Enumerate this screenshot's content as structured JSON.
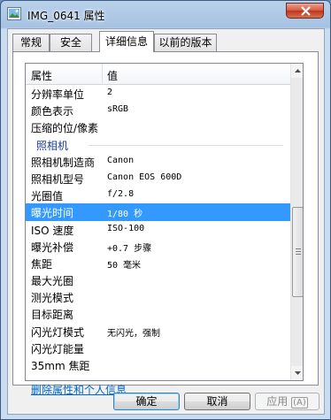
{
  "window": {
    "title": "IMG_0641 属性"
  },
  "tabs": [
    {
      "label": "常规",
      "active": false
    },
    {
      "label": "安全",
      "active": false
    },
    {
      "label": "详细信息",
      "active": true
    },
    {
      "label": "以前的版本",
      "active": false
    }
  ],
  "list": {
    "headers": {
      "name": "属性",
      "value": "值"
    },
    "rows": [
      {
        "name": "分辨率单位",
        "value": "2"
      },
      {
        "name": "颜色表示",
        "value": "sRGB"
      },
      {
        "name": "压缩的位/像素",
        "value": ""
      },
      {
        "name": "照相机",
        "value": "",
        "group": true
      },
      {
        "name": "照相机制造商",
        "value": "Canon"
      },
      {
        "name": "照相机型号",
        "value": "Canon EOS 600D"
      },
      {
        "name": "光圈值",
        "value": "f/2.8"
      },
      {
        "name": "曝光时间",
        "value": "1/80 秒",
        "selected": true
      },
      {
        "name": "ISO 速度",
        "value": "ISO-100"
      },
      {
        "name": "曝光补偿",
        "value": "+0.7 步骤"
      },
      {
        "name": "焦距",
        "value": "50 毫米"
      },
      {
        "name": "最大光圈",
        "value": ""
      },
      {
        "name": "测光模式",
        "value": ""
      },
      {
        "name": "目标距离",
        "value": ""
      },
      {
        "name": "闪光灯模式",
        "value": "无闪光，强制"
      },
      {
        "name": "闪光灯能量",
        "value": ""
      },
      {
        "name": "35mm 焦距",
        "value": ""
      }
    ]
  },
  "link": {
    "label": "删除属性和个人信息"
  },
  "buttons": {
    "ok": "确定",
    "cancel": "取消",
    "apply": "应用",
    "apply_accel": "A"
  },
  "colors": {
    "selection": "#3399ff",
    "link": "#0066cc",
    "group": "#1e3e96"
  }
}
